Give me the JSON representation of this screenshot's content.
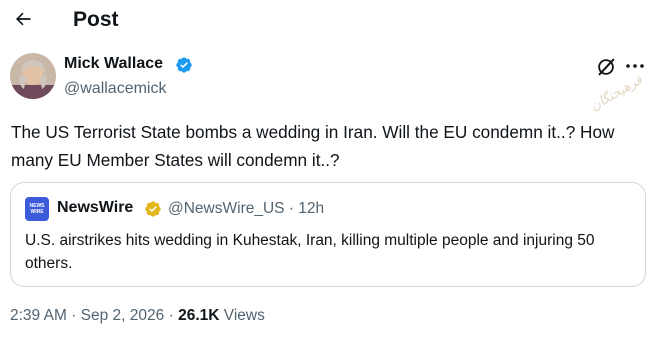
{
  "header": {
    "title": "Post"
  },
  "author": {
    "name": "Mick Wallace",
    "handle": "@wallacemick"
  },
  "watermark": "فرهيختگان",
  "tweet": {
    "text": "The US Terrorist State bombs a wedding in Iran. Will the EU condemn it..? How many EU Member States will condemn it..?"
  },
  "quote": {
    "logo_top": "NEWS",
    "logo_bottom": "WIRE",
    "name": "NewsWire",
    "handle": "@NewsWire_US",
    "separator": "·",
    "time": "12h",
    "text": "U.S. airstrikes hits wedding in Kuhestak, Iran, killing multiple people and injuring 50 others."
  },
  "footer": {
    "time": "2:39 AM",
    "separator": "·",
    "date": "Sep 2, 2026",
    "views_count": "26.1K",
    "views_label": "Views"
  },
  "colors": {
    "text": "#0f1419",
    "secondary": "#536471",
    "verified_blue": "#1d9bf0",
    "verified_gold": "#e2b719",
    "border": "#cfd9de"
  },
  "icons": [
    "back-arrow-icon",
    "verified-badge-icon",
    "grok-icon",
    "more-icon",
    "gold-verified-badge-icon"
  ]
}
